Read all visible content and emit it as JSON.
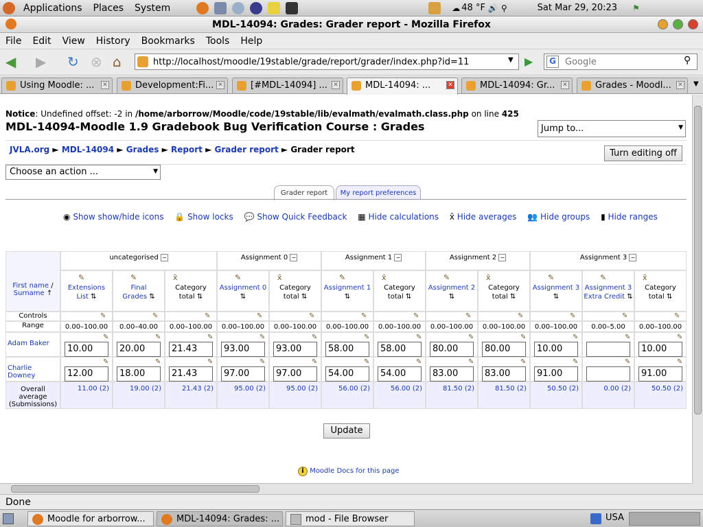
{
  "panel": {
    "menus": [
      "Applications",
      "Places",
      "System"
    ],
    "weather": "48 °F",
    "datetime": "Sat Mar 29, 20:23"
  },
  "window": {
    "title": "MDL-14094: Grades: Grader report - Mozilla Firefox"
  },
  "menubar": [
    "File",
    "Edit",
    "View",
    "History",
    "Bookmarks",
    "Tools",
    "Help"
  ],
  "nav": {
    "url": "http://localhost/moodle/19stable/grade/report/grader/index.php?id=11",
    "search_placeholder": "Google"
  },
  "tabs": [
    "Using Moodle: ...",
    "Development:Fi...",
    "[#MDL-14094] ...",
    "MDL-14094: ...",
    "MDL-14094: Gr...",
    "Grades - Moodl..."
  ],
  "page": {
    "notice_label": "Notice",
    "notice_text": ": Undefined offset: -2 in",
    "notice_path": "/home/arborrow/Moodle/code/19stable/lib/evalmath/evalmath.class.php",
    "notice_online": "on line",
    "notice_line": "425",
    "heading": "MDL-14094-Moodle 1.9 Gradebook Bug Verification Course : Grades",
    "jump_to": "Jump to...",
    "breadcrumb": [
      "JVLA.org",
      "MDL-14094",
      "Grades",
      "Report",
      "Grader report",
      "Grader report"
    ],
    "editing_button": "Turn editing off",
    "action_select": "Choose an action ...",
    "subtabs": [
      "Grader report",
      "My report preferences"
    ],
    "toggles": [
      "Show show/hide icons",
      "Show locks",
      "Show Quick Feedback",
      "Hide calculations",
      "Hide averages",
      "Hide groups",
      "Hide ranges"
    ],
    "groups": [
      "uncategorised",
      "Assignment 0",
      "Assignment 1",
      "Assignment 2",
      "Assignment 3"
    ],
    "name_header_first": "First name",
    "name_header_sep": " / ",
    "name_header_last": "Surname",
    "columns": [
      [
        "Extensions",
        "List"
      ],
      [
        "Final",
        "Grades"
      ],
      [
        "Category",
        "total"
      ],
      [
        "Assignment 0",
        ""
      ],
      [
        "Category",
        "total"
      ],
      [
        "Assignment 1",
        ""
      ],
      [
        "Category",
        "total"
      ],
      [
        "Assignment 2",
        ""
      ],
      [
        "Category",
        "total"
      ],
      [
        "Assignment 3",
        ""
      ],
      [
        "Assignment 3",
        "Extra Credit"
      ],
      [
        "Category",
        "total"
      ]
    ],
    "controls_label": "Controls",
    "range_label": "Range",
    "ranges": [
      "0.00–100.00",
      "0.00–40.00",
      "0.00–100.00",
      "0.00–100.00",
      "0.00–100.00",
      "0.00–100.00",
      "0.00–100.00",
      "0.00–100.00",
      "0.00–100.00",
      "0.00–100.00",
      "0.00–5.00",
      "0.00–100.00"
    ],
    "students": [
      {
        "name": "Adam Baker",
        "grades": [
          "10.00",
          "20.00",
          "21.43",
          "93.00",
          "93.00",
          "58.00",
          "58.00",
          "80.00",
          "80.00",
          "10.00",
          "",
          "10.00"
        ]
      },
      {
        "name": "Charlie Downey",
        "grades": [
          "12.00",
          "18.00",
          "21.43",
          "97.00",
          "97.00",
          "54.00",
          "54.00",
          "83.00",
          "83.00",
          "91.00",
          "",
          "91.00"
        ]
      }
    ],
    "avg_label": [
      "Overall",
      "average",
      "(Submissions)"
    ],
    "averages": [
      "11.00 (2)",
      "19.00 (2)",
      "21.43 (2)",
      "95.00 (2)",
      "95.00 (2)",
      "56.00 (2)",
      "56.00 (2)",
      "81.50 (2)",
      "81.50 (2)",
      "50.50 (2)",
      "0.00 (2)",
      "50.50 (2)"
    ],
    "update_button": "Update",
    "docs_link": "Moodle Docs for this page"
  },
  "status": "Done",
  "taskbar": [
    "Moodle for arborrow...",
    "MDL-14094: Grades: ...",
    "mod - File Browser"
  ],
  "locale": "USA"
}
